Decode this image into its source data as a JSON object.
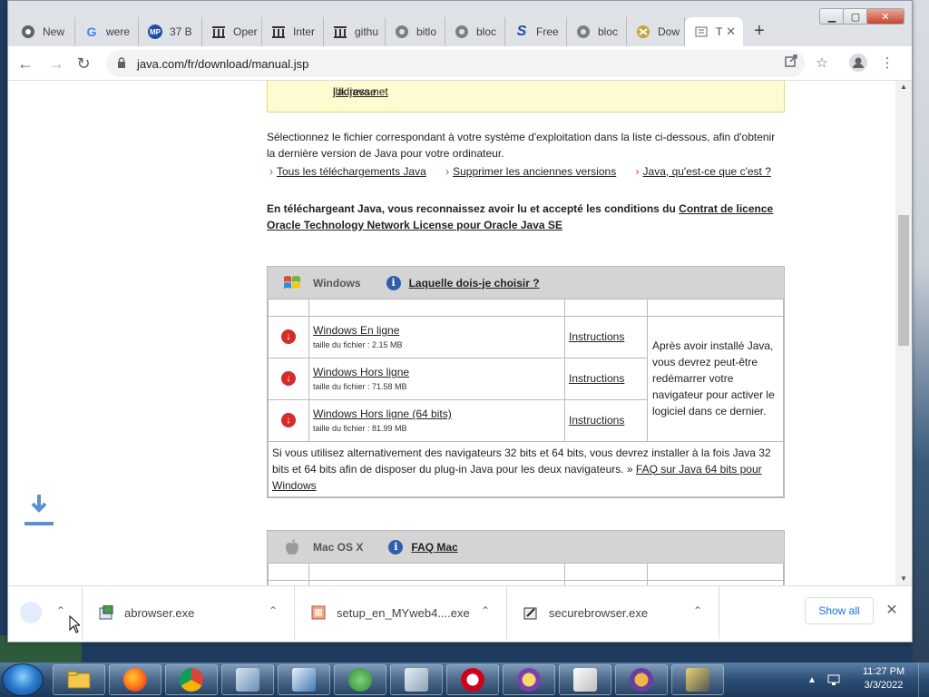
{
  "browser": {
    "tabs": [
      {
        "label": "New",
        "icon": "chrome-icon"
      },
      {
        "label": "were",
        "icon": "google-icon"
      },
      {
        "label": "37 B",
        "icon": "mp-icon"
      },
      {
        "label": "Oper",
        "icon": "archive-icon"
      },
      {
        "label": "Inter",
        "icon": "archive-icon"
      },
      {
        "label": "githu",
        "icon": "archive-icon"
      },
      {
        "label": "bitlo",
        "icon": "globe-icon"
      },
      {
        "label": "bloc",
        "icon": "globe-icon"
      },
      {
        "label": "Free",
        "icon": "s-icon"
      },
      {
        "label": "bloc",
        "icon": "globe-icon"
      },
      {
        "label": "Dow",
        "icon": "download-site-icon"
      },
      {
        "label": "T",
        "icon": "java-icon",
        "active": true
      }
    ],
    "url": "java.com/fr/download/manual.jsp"
  },
  "page": {
    "notice_prefix": "l'adresse ",
    "notice_link": "jdk.java.net",
    "notice_suffix": ".",
    "intro_line1": "Sélectionnez le fichier correspondant à votre système d'exploitation dans la liste ci-dessous, afin d'obtenir",
    "intro_line2": "la dernière version de Java pour votre ordinateur.",
    "links": [
      "Tous les téléchargements Java",
      "Supprimer les anciennes versions",
      "Java, qu'est-ce que c'est ?"
    ],
    "license_text": "En téléchargeant Java, vous reconnaissez avoir lu et accepté les conditions du ",
    "license_link": "Contrat de licence Oracle Technology Network License pour Oracle Java SE",
    "windows": {
      "title": "Windows",
      "help_link": "Laquelle dois-je choisir ?",
      "rows": [
        {
          "name": "Windows En ligne",
          "size": "taille du fichier : 2.15 MB",
          "instructions": "Instructions"
        },
        {
          "name": "Windows Hors ligne",
          "size": "taille du fichier : 71.58 MB",
          "instructions": "Instructions"
        },
        {
          "name": "Windows Hors ligne (64 bits)",
          "size": "taille du fichier : 81.99 MB",
          "instructions": "Instructions"
        }
      ],
      "side_note": "Après avoir installé Java, vous devrez peut-être redémarrer votre navigateur pour activer le logiciel dans ce dernier.",
      "footnote": "Si vous utilisez alternativement des navigateurs 32 bits et 64 bits, vous devrez installer à la fois Java 32 bits et 64 bits afin de disposer du plug-in Java pour les deux navigateurs. » ",
      "footnote_link": "FAQ sur Java 64 bits pour Windows"
    },
    "mac": {
      "title": "Mac OS X",
      "help_link": "FAQ Mac"
    }
  },
  "downloads": {
    "items": [
      {
        "name": "abrowser.exe"
      },
      {
        "name": "setup_en_MYweb4....exe"
      },
      {
        "name": "securebrowser.exe"
      }
    ],
    "show_all": "Show all"
  },
  "taskbar": {
    "time": "11:27 PM",
    "date": "3/3/2022"
  },
  "colors": {
    "notice_bg": "#fffbd0",
    "section_header": "#d4d4d4",
    "download_red": "#d42b2b",
    "info_blue": "#2f5fa8",
    "link_blue": "#1a73e8"
  }
}
